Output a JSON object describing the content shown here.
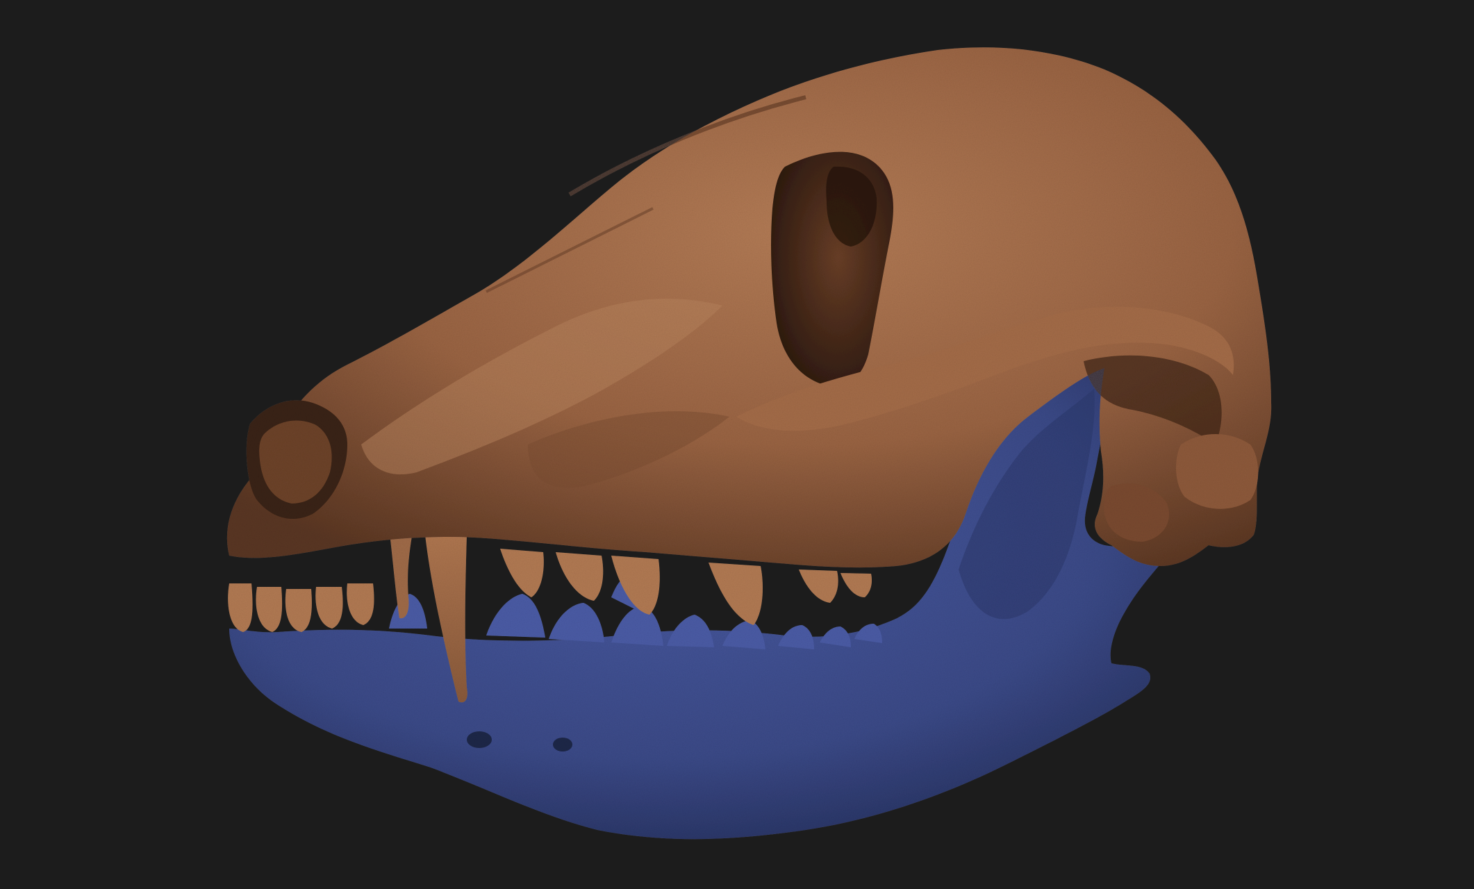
{
  "scene": {
    "background_color": "#1c1c1c",
    "subject": "skull-3d-mesh",
    "cranium_color": "#a8714d",
    "mandible_color": "#3f4f91"
  }
}
